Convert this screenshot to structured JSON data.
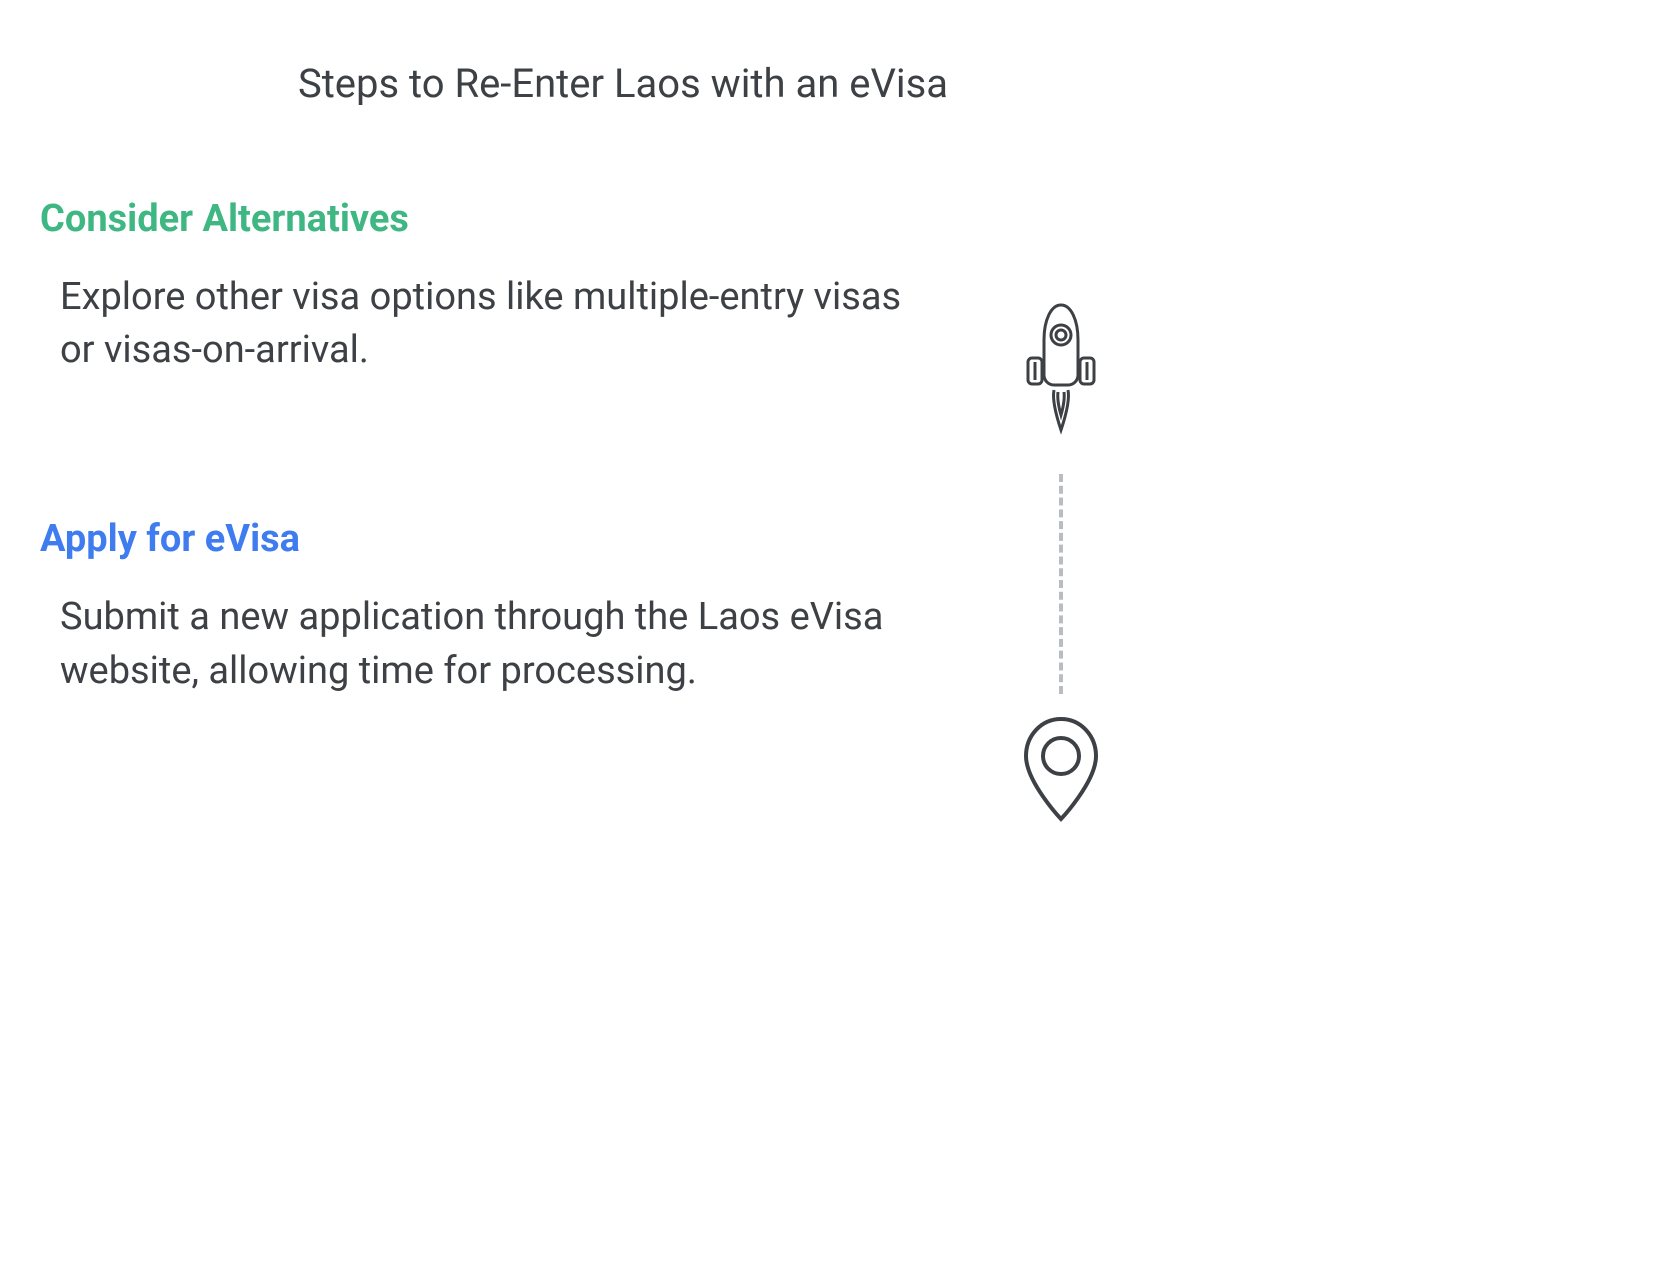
{
  "title": "Steps to Re-Enter Laos with an eVisa",
  "steps": [
    {
      "heading": "Consider Alternatives",
      "body": "Explore other visa options like multiple-entry visas or visas-on-arrival.",
      "color": "#3fb783"
    },
    {
      "heading": "Apply for eVisa",
      "body": "Submit a new application through the Laos eVisa website, allowing time for processing.",
      "color": "#3f7cf0"
    }
  ]
}
